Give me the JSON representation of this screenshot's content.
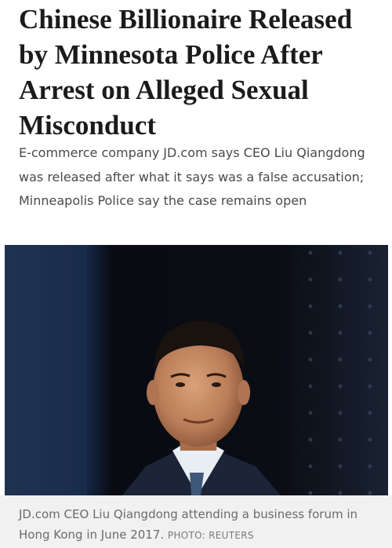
{
  "article": {
    "headline": "Chinese Billionaire Released by Minnesota Police After Arrest on Alleged Sexual Misconduct",
    "dek": "E-commerce company JD.com says CEO Liu Qiangdong was released after what it says was a false accusation; Minneapolis Police say the case remains open"
  },
  "photo": {
    "caption": "JD.com CEO Liu Qiangdong attending a business forum in Hong Kong in June 2017.",
    "credit": "PHOTO: REUTERS"
  }
}
